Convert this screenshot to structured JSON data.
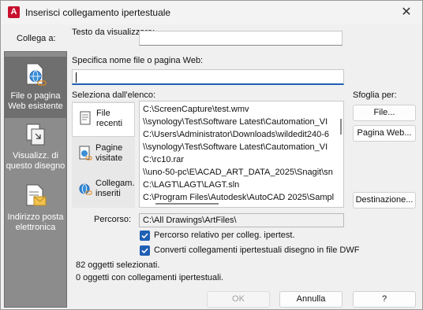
{
  "window": {
    "title": "Inserisci collegamento ipertestuale",
    "app_icon_letter": "A"
  },
  "nav": {
    "heading": "Collega a:",
    "items": [
      {
        "label": "File o pagina Web esistente",
        "icon": "globe-page-icon",
        "selected": true
      },
      {
        "label": "Visualizz. di questo disegno",
        "icon": "drawing-view-icon",
        "selected": false
      },
      {
        "label": "Indirizzo posta elettronica",
        "icon": "envelope-icon",
        "selected": false
      }
    ]
  },
  "display_text": {
    "label": "Testo da visualizzare:",
    "value": ""
  },
  "file_or_web": {
    "label": "Specifica nome file o pagina Web:",
    "value": ""
  },
  "list_section": {
    "label": "Seleziona dall'elenco:",
    "tabs": [
      {
        "label": "File recenti",
        "icon": "recent-files-icon"
      },
      {
        "label": "Pagine visitate",
        "icon": "visited-pages-icon"
      },
      {
        "label": "Collegam. inseriti",
        "icon": "inserted-links-icon"
      }
    ],
    "items": [
      "C:\\ScreenCapture\\test.wmv",
      "\\\\synology\\Test\\Software Latest\\Cautomation_VI",
      "C:\\Users\\Administrator\\Downloads\\wildedit240-6",
      "\\\\synology\\Test\\Software Latest\\Cautomation_VI",
      "C:\\rc10.rar",
      "\\\\uno-50-pc\\E\\ACAD_ART_DATA_2025\\Snagit\\sn",
      "C:\\LAGT\\LAGT\\LAGT.sln",
      "C:\\Program Files\\Autodesk\\AutoCAD 2025\\Sampl"
    ]
  },
  "browse": {
    "label": "Sfoglia per:",
    "file_button": "File...",
    "web_button": "Pagina Web...",
    "target_button": "Destinazione..."
  },
  "path": {
    "label": "Percorso:",
    "value": "C:\\All Drawings\\ArtFiles\\"
  },
  "options": {
    "relative_path": {
      "label": "Percorso relativo per colleg. ipertest.",
      "checked": true
    },
    "convert_dwf": {
      "label": "Converti collegamenti ipertestuali disegno in file DWF",
      "checked": true
    }
  },
  "status": {
    "selected_count": "82 oggetti selezionati.",
    "linked_count": "0 oggetti con collegamenti ipertestuali."
  },
  "footer": {
    "ok": "OK",
    "cancel": "Annulla",
    "help": "?"
  },
  "colors": {
    "accent": "#1f5fb4",
    "nav_bg": "#8c8c8c",
    "nav_selected": "#6f6f6f",
    "app_red": "#c8102e"
  }
}
